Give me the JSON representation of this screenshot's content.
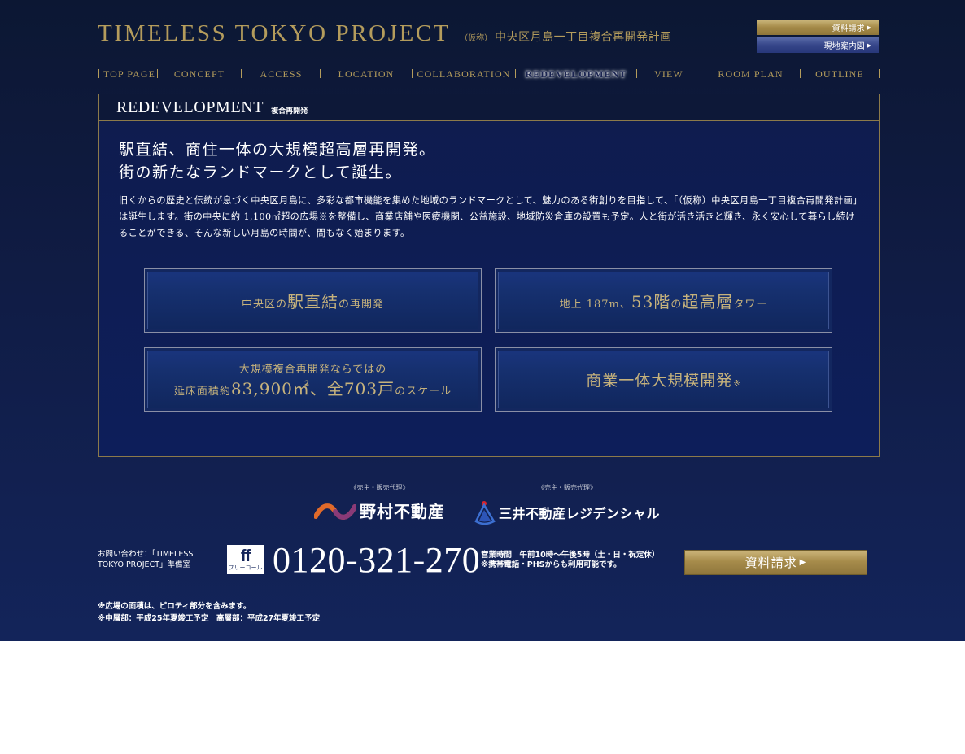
{
  "header": {
    "title": "TIMELESS TOKYO PROJECT",
    "subtitle_prefix": "（仮称）",
    "subtitle": "中央区月島一丁目複合再開発計画",
    "doc_request_label": "資料請求",
    "site_map_label": "現地案内図"
  },
  "nav": {
    "items": [
      {
        "label": "TOP PAGE"
      },
      {
        "label": "CONCEPT"
      },
      {
        "label": "ACCESS"
      },
      {
        "label": "LOCATION"
      },
      {
        "label": "COLLABORATION"
      },
      {
        "label": "REDEVELOPMENT"
      },
      {
        "label": "VIEW"
      },
      {
        "label": "ROOM PLAN"
      },
      {
        "label": "OUTLINE"
      }
    ],
    "active": "REDEVELOPMENT"
  },
  "section": {
    "title": "REDEVELOPMENT",
    "title_sub": "複合再開発",
    "lead_line1": "駅直結、商住一体の大規模超高層再開発。",
    "lead_line2": "街の新たなランドマークとして誕生。",
    "body": "旧くからの歴史と伝統が息づく中央区月島に、多彩な都市機能を集めた地域のランドマークとして、魅力のある街創りを目指して、「（仮称）中央区月島一丁目複合再開発計画」は誕生します。街の中央に約 1,100㎡超の広場※を整備し、商業店舗や医療機関、公益施設、地域防災倉庫の設置も予定。人と街が活き活きと輝き、永く安心して暮らし続けることができる、そんな新しい月島の時間が、間もなく始まります。"
  },
  "features": {
    "f1": {
      "a": "中央区の",
      "b": "駅直結",
      "c": "の再開発"
    },
    "f2": {
      "a": "地上 187m、",
      "b": "53階",
      "c": " の ",
      "d": "超高層",
      "e": "タワー"
    },
    "f3": {
      "line1": "大規模複合再開発ならではの",
      "a": "延床面積約",
      "b": "83,900㎡、全703戸",
      "c": "のスケール"
    },
    "f4": {
      "label": "商業一体大規模開発",
      "mark": "※"
    }
  },
  "sponsors": {
    "nomura": {
      "role": "《売主・販売代理》",
      "name": "野村不動産"
    },
    "mitsui": {
      "role": "《売主・販売代理》",
      "name": "三井不動産レジデンシャル"
    }
  },
  "contact": {
    "label": "お問い合わせ：「TIMELESS TOKYO PROJECT」準備室",
    "freecall_mark": "ff",
    "freecall_text": "フリーコール",
    "phone": "0120-321-270",
    "hours": "営業時間　午前10時〜午後5時（土・日・祝定休）",
    "mobile_note": "※携帯電話・PHSからも利用可能です。",
    "doc_request_label": "資料請求"
  },
  "notes": {
    "line1": "※広場の面積は、ピロティ部分を含みます。",
    "line2": "※中層部：平成25年夏竣工予定　高層部：平成27年夏竣工予定"
  },
  "colors": {
    "gold": "#b49c5c",
    "navy": "#101c45",
    "frame_border": "#8c7a4a"
  }
}
